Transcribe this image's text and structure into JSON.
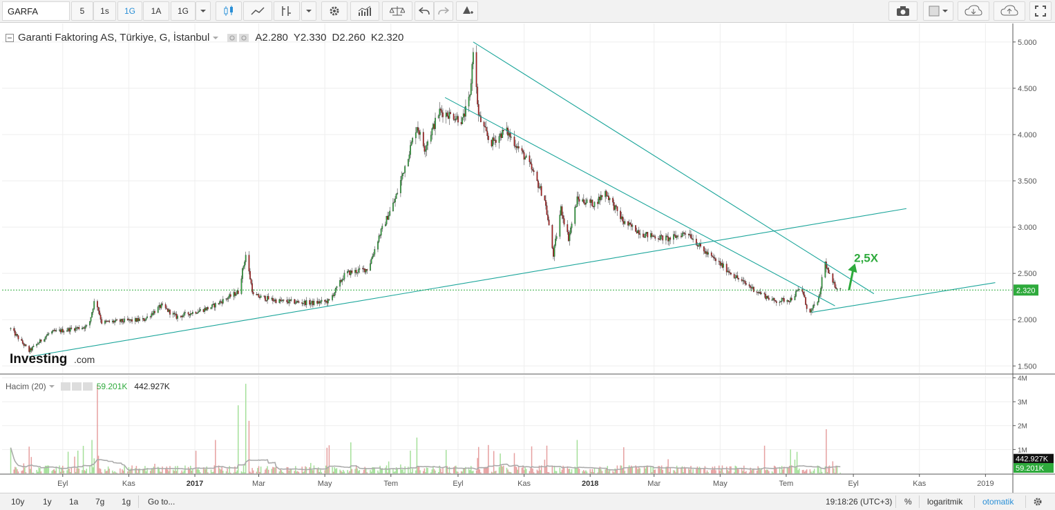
{
  "toolbar": {
    "symbol": "GARFA",
    "intervals": [
      "5",
      "1s",
      "1G",
      "1A",
      "1G"
    ],
    "active_interval_index": 2
  },
  "legend": {
    "title": "Garanti Faktoring AS, Türkiye, G, İstanbul",
    "open": "A2.280",
    "high": "Y2.330",
    "low": "D2.260",
    "close": "K2.320"
  },
  "volume_legend": {
    "label": "Hacim (20)",
    "value1": "59.201K",
    "value2": "442.927K"
  },
  "logo": {
    "main": "Investing",
    "suffix": ".com"
  },
  "annotation": {
    "text": "2,5X",
    "color": "#2eaa3c"
  },
  "bottombar": {
    "ranges": [
      "10y",
      "1y",
      "1a",
      "7g",
      "1g",
      "Go to..."
    ],
    "time": "19:18:26 (UTC+3)",
    "percent": "%",
    "log": "logaritmik",
    "auto": "otomatik"
  },
  "colors": {
    "up": "#2eaa3c",
    "down": "#b51d1d",
    "trend": "#1aa59a",
    "axis": "#555555"
  },
  "chart_data": {
    "type": "candlestick",
    "price_axis": {
      "ticks": [
        5.0,
        4.5,
        4.0,
        3.5,
        3.0,
        2.5,
        2.0,
        1.5
      ],
      "tick_labels": [
        "5.000",
        "4.500",
        "4.000",
        "3.500",
        "3.000",
        "2.500",
        "2.000",
        "1.500"
      ],
      "range": [
        1.42,
        5.2
      ]
    },
    "volume_axis": {
      "ticks": [
        4000000,
        3000000,
        2000000,
        1000000
      ],
      "tick_labels": [
        "4M",
        "3M",
        "2M",
        "1M"
      ],
      "range": [
        0,
        4100000
      ]
    },
    "x_ticks": [
      "Eyl",
      "Kas",
      "2017",
      "Mar",
      "May",
      "Tem",
      "Eyl",
      "Kas",
      "2018",
      "Mar",
      "May",
      "Tem",
      "Eyl",
      "Kas",
      "2019"
    ],
    "bold_ticks": [
      "2017",
      "2018"
    ],
    "last_price": 2.32,
    "last_price_label": "2.320",
    "volume_badges": [
      {
        "text": "442.927K",
        "value": 442927
      },
      {
        "text": "59.201K",
        "value": 59201
      }
    ],
    "key_points": [
      {
        "date": "2016-07-15",
        "price": 1.9
      },
      {
        "date": "2016-08-01",
        "price": 1.66
      },
      {
        "date": "2016-08-20",
        "price": 1.86
      },
      {
        "date": "2016-09-25",
        "price": 1.93
      },
      {
        "date": "2016-10-01",
        "price": 2.24
      },
      {
        "date": "2016-10-07",
        "price": 1.97
      },
      {
        "date": "2016-11-15",
        "price": 2.0
      },
      {
        "date": "2016-12-01",
        "price": 2.15
      },
      {
        "date": "2016-12-15",
        "price": 2.03
      },
      {
        "date": "2017-01-15",
        "price": 2.13
      },
      {
        "date": "2017-02-10",
        "price": 2.3
      },
      {
        "date": "2017-02-17",
        "price": 2.7
      },
      {
        "date": "2017-02-24",
        "price": 2.26
      },
      {
        "date": "2017-03-20",
        "price": 2.2
      },
      {
        "date": "2017-04-20",
        "price": 2.18
      },
      {
        "date": "2017-05-05",
        "price": 2.2
      },
      {
        "date": "2017-05-20",
        "price": 2.5
      },
      {
        "date": "2017-06-10",
        "price": 2.55
      },
      {
        "date": "2017-06-20",
        "price": 2.9
      },
      {
        "date": "2017-07-05",
        "price": 3.3
      },
      {
        "date": "2017-07-15",
        "price": 3.7
      },
      {
        "date": "2017-07-25",
        "price": 4.1
      },
      {
        "date": "2017-08-01",
        "price": 3.85
      },
      {
        "date": "2017-08-15",
        "price": 4.25
      },
      {
        "date": "2017-08-28",
        "price": 4.2
      },
      {
        "date": "2017-09-05",
        "price": 4.15
      },
      {
        "date": "2017-09-12",
        "price": 4.4
      },
      {
        "date": "2017-09-15",
        "price": 4.93
      },
      {
        "date": "2017-09-20",
        "price": 4.2
      },
      {
        "date": "2017-10-01",
        "price": 3.9
      },
      {
        "date": "2017-10-15",
        "price": 4.05
      },
      {
        "date": "2017-11-05",
        "price": 3.7
      },
      {
        "date": "2017-11-20",
        "price": 3.3
      },
      {
        "date": "2017-11-28",
        "price": 2.7
      },
      {
        "date": "2017-12-05",
        "price": 3.2
      },
      {
        "date": "2017-12-12",
        "price": 2.88
      },
      {
        "date": "2017-12-20",
        "price": 3.3
      },
      {
        "date": "2018-01-05",
        "price": 3.25
      },
      {
        "date": "2018-01-15",
        "price": 3.38
      },
      {
        "date": "2018-02-01",
        "price": 3.05
      },
      {
        "date": "2018-02-20",
        "price": 2.92
      },
      {
        "date": "2018-03-15",
        "price": 2.87
      },
      {
        "date": "2018-04-01",
        "price": 2.95
      },
      {
        "date": "2018-04-15",
        "price": 2.75
      },
      {
        "date": "2018-05-01",
        "price": 2.6
      },
      {
        "date": "2018-05-20",
        "price": 2.42
      },
      {
        "date": "2018-06-05",
        "price": 2.3
      },
      {
        "date": "2018-06-20",
        "price": 2.2
      },
      {
        "date": "2018-07-05",
        "price": 2.22
      },
      {
        "date": "2018-07-15",
        "price": 2.35
      },
      {
        "date": "2018-07-22",
        "price": 2.05
      },
      {
        "date": "2018-08-01",
        "price": 2.25
      },
      {
        "date": "2018-08-05",
        "price": 2.65
      },
      {
        "date": "2018-08-12",
        "price": 2.4
      },
      {
        "date": "2018-08-20",
        "price": 2.32
      }
    ],
    "volume_spikes": [
      {
        "date": "2016-10-03",
        "value": 3700000,
        "dir": "down"
      },
      {
        "date": "2016-09-28",
        "value": 1400000,
        "dir": "up"
      },
      {
        "date": "2017-01-20",
        "value": 1400000,
        "dir": "down"
      },
      {
        "date": "2017-02-10",
        "value": 2850000,
        "dir": "up"
      },
      {
        "date": "2017-02-17",
        "value": 3750000,
        "dir": "up"
      },
      {
        "date": "2017-02-20",
        "value": 2200000,
        "dir": "down"
      },
      {
        "date": "2017-05-25",
        "value": 1300000,
        "dir": "up"
      },
      {
        "date": "2017-07-25",
        "value": 1500000,
        "dir": "up"
      },
      {
        "date": "2017-08-20",
        "value": 1200000,
        "dir": "down"
      },
      {
        "date": "2017-12-20",
        "value": 1400000,
        "dir": "up"
      },
      {
        "date": "2018-08-05",
        "value": 3400000,
        "dir": "up"
      },
      {
        "date": "2018-08-07",
        "value": 1850000,
        "dir": "down"
      }
    ],
    "trendlines": [
      {
        "from": {
          "date": "2016-08-01",
          "price": 1.6
        },
        "to": {
          "date": "2018-10-20",
          "price": 3.2
        }
      },
      {
        "from": {
          "date": "2017-09-15",
          "price": 5.0
        },
        "to": {
          "date": "2018-09-20",
          "price": 2.28
        }
      },
      {
        "from": {
          "date": "2017-08-20",
          "price": 4.4
        },
        "to": {
          "date": "2018-08-15",
          "price": 2.15
        }
      },
      {
        "from": {
          "date": "2018-07-25",
          "price": 2.08
        },
        "to": {
          "date": "2019-01-10",
          "price": 2.4
        }
      }
    ],
    "annotation_arrow": {
      "from": {
        "date": "2018-08-28",
        "price": 2.32
      },
      "to": {
        "date": "2018-09-01",
        "price": 2.55
      }
    }
  }
}
